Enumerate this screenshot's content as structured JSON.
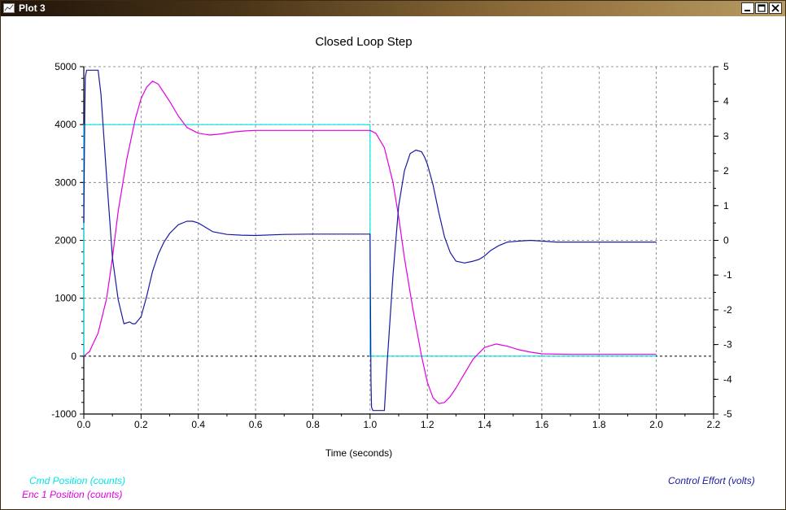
{
  "window": {
    "title": "Plot 3",
    "titlebar_colors": [
      "#1f140a",
      "#b89a62"
    ]
  },
  "legend": {
    "left": [
      {
        "label": "Cmd Position (counts)",
        "color": "#00e5e5"
      },
      {
        "label": "Enc 1 Position (counts)",
        "color": "#e000e0"
      }
    ],
    "right": [
      {
        "label": "Control Effort (volts)",
        "color": "#1a1aa0"
      }
    ]
  },
  "chart_data": {
    "type": "line",
    "title": "Closed Loop Step",
    "xlabel": "Time (seconds)",
    "ylabel": "",
    "y2label": "",
    "xlim": [
      0.0,
      2.2
    ],
    "ylim": [
      -1000,
      5000
    ],
    "y2lim": [
      -5,
      5
    ],
    "x_ticks": [
      "0.0",
      "0.2",
      "0.4",
      "0.6",
      "0.8",
      "1.0",
      "1.2",
      "1.4",
      "1.6",
      "1.8",
      "2.0",
      "2.2"
    ],
    "y_ticks": [
      "5000",
      "4000",
      "3000",
      "2000",
      "1000",
      "0",
      "-1000"
    ],
    "y2_ticks": [
      "5",
      "4",
      "3",
      "2",
      "1",
      "0",
      "-1",
      "-2",
      "-3",
      "-4",
      "-5"
    ],
    "grid": true,
    "series": [
      {
        "name": "Cmd Position (counts)",
        "axis": "left",
        "color": "#00e5e5",
        "x": [
          0.0,
          0.0,
          1.0,
          1.0,
          2.0
        ],
        "y": [
          0,
          4000,
          4000,
          0,
          0
        ]
      },
      {
        "name": "Enc 1 Position (counts)",
        "axis": "left",
        "color": "#e000e0",
        "x": [
          0.0,
          0.02,
          0.05,
          0.08,
          0.1,
          0.12,
          0.15,
          0.18,
          0.2,
          0.22,
          0.24,
          0.26,
          0.28,
          0.3,
          0.33,
          0.36,
          0.4,
          0.44,
          0.48,
          0.52,
          0.56,
          0.6,
          0.7,
          0.8,
          0.9,
          0.98,
          1.0,
          1.02,
          1.05,
          1.08,
          1.1,
          1.12,
          1.15,
          1.18,
          1.2,
          1.22,
          1.24,
          1.26,
          1.28,
          1.3,
          1.33,
          1.36,
          1.4,
          1.44,
          1.48,
          1.52,
          1.56,
          1.6,
          1.7,
          1.8,
          1.9,
          2.0
        ],
        "y": [
          0,
          80,
          400,
          1000,
          1700,
          2500,
          3400,
          4100,
          4450,
          4650,
          4750,
          4700,
          4550,
          4400,
          4150,
          3950,
          3850,
          3820,
          3840,
          3870,
          3890,
          3900,
          3900,
          3900,
          3900,
          3900,
          3900,
          3850,
          3600,
          3000,
          2400,
          1700,
          800,
          0,
          -450,
          -720,
          -820,
          -800,
          -700,
          -550,
          -300,
          -50,
          150,
          210,
          170,
          110,
          70,
          40,
          30,
          30,
          30,
          30
        ]
      },
      {
        "name": "Control Effort (volts)",
        "axis": "right",
        "color": "#1a1aa0",
        "x": [
          0.0,
          0.003,
          0.005,
          0.01,
          0.015,
          0.02,
          0.03,
          0.05,
          0.06,
          0.08,
          0.1,
          0.12,
          0.14,
          0.16,
          0.17,
          0.18,
          0.2,
          0.22,
          0.24,
          0.26,
          0.28,
          0.3,
          0.33,
          0.36,
          0.38,
          0.4,
          0.42,
          0.45,
          0.5,
          0.55,
          0.6,
          0.7,
          0.8,
          0.9,
          0.99,
          1.0,
          1.003,
          1.005,
          1.01,
          1.03,
          1.05,
          1.06,
          1.08,
          1.1,
          1.12,
          1.14,
          1.16,
          1.18,
          1.19,
          1.2,
          1.22,
          1.24,
          1.26,
          1.28,
          1.3,
          1.33,
          1.36,
          1.38,
          1.4,
          1.42,
          1.45,
          1.48,
          1.52,
          1.56,
          1.6,
          1.65,
          1.7,
          1.8,
          1.9,
          2.0
        ],
        "y": [
          0.5,
          3.5,
          4.7,
          4.9,
          4.9,
          4.9,
          4.9,
          4.9,
          4.2,
          1.8,
          -0.5,
          -1.7,
          -2.4,
          -2.35,
          -2.4,
          -2.4,
          -2.2,
          -1.6,
          -0.9,
          -0.4,
          -0.05,
          0.2,
          0.45,
          0.55,
          0.55,
          0.5,
          0.4,
          0.25,
          0.17,
          0.15,
          0.14,
          0.17,
          0.18,
          0.18,
          0.18,
          0.18,
          -4.0,
          -4.8,
          -4.9,
          -4.9,
          -4.9,
          -3.5,
          -1.0,
          1.0,
          2.0,
          2.5,
          2.6,
          2.55,
          2.4,
          2.2,
          1.6,
          0.8,
          0.1,
          -0.35,
          -0.6,
          -0.65,
          -0.6,
          -0.55,
          -0.45,
          -0.3,
          -0.15,
          -0.05,
          -0.02,
          0.0,
          -0.02,
          -0.05,
          -0.05,
          -0.05,
          -0.05,
          -0.05
        ]
      }
    ]
  }
}
